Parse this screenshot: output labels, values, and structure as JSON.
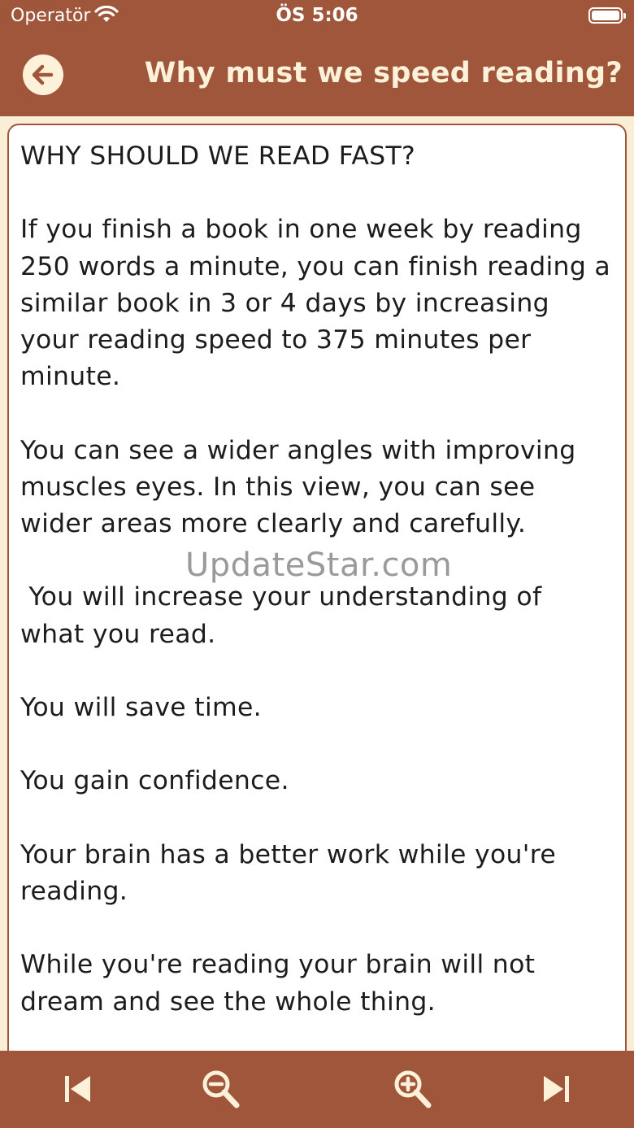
{
  "status_bar": {
    "carrier": "Operatör",
    "time": "ÖS 5:06"
  },
  "nav": {
    "title": "Why must we speed reading?",
    "back_icon": "arrow-left-circle-icon"
  },
  "content": {
    "paragraphs": [
      "WHY SHOULD WE READ FAST?",
      "If you finish a book in one week by reading 250 words a minute, you can finish reading a similar book in 3 or 4 days by increasing your reading speed to 375 minutes per minute.",
      "You can see a wider angles with improving muscles eyes. In this view, you can see wider areas more clearly and carefully.",
      " You will increase your understanding of what you read.",
      "You will save time.",
      "You gain confidence.",
      "Your brain has a better work while you're reading.",
      "While you're reading your brain will not dream and see the whole thing."
    ]
  },
  "watermark": "UpdateStar.com",
  "toolbar": {
    "icons": [
      "skip-previous-icon",
      "zoom-out-icon",
      "zoom-in-icon",
      "skip-next-icon"
    ]
  },
  "colors": {
    "bar": "#a0563a",
    "background": "#fbeed7",
    "card": "#ffffff",
    "icon": "#fdf1d9"
  }
}
